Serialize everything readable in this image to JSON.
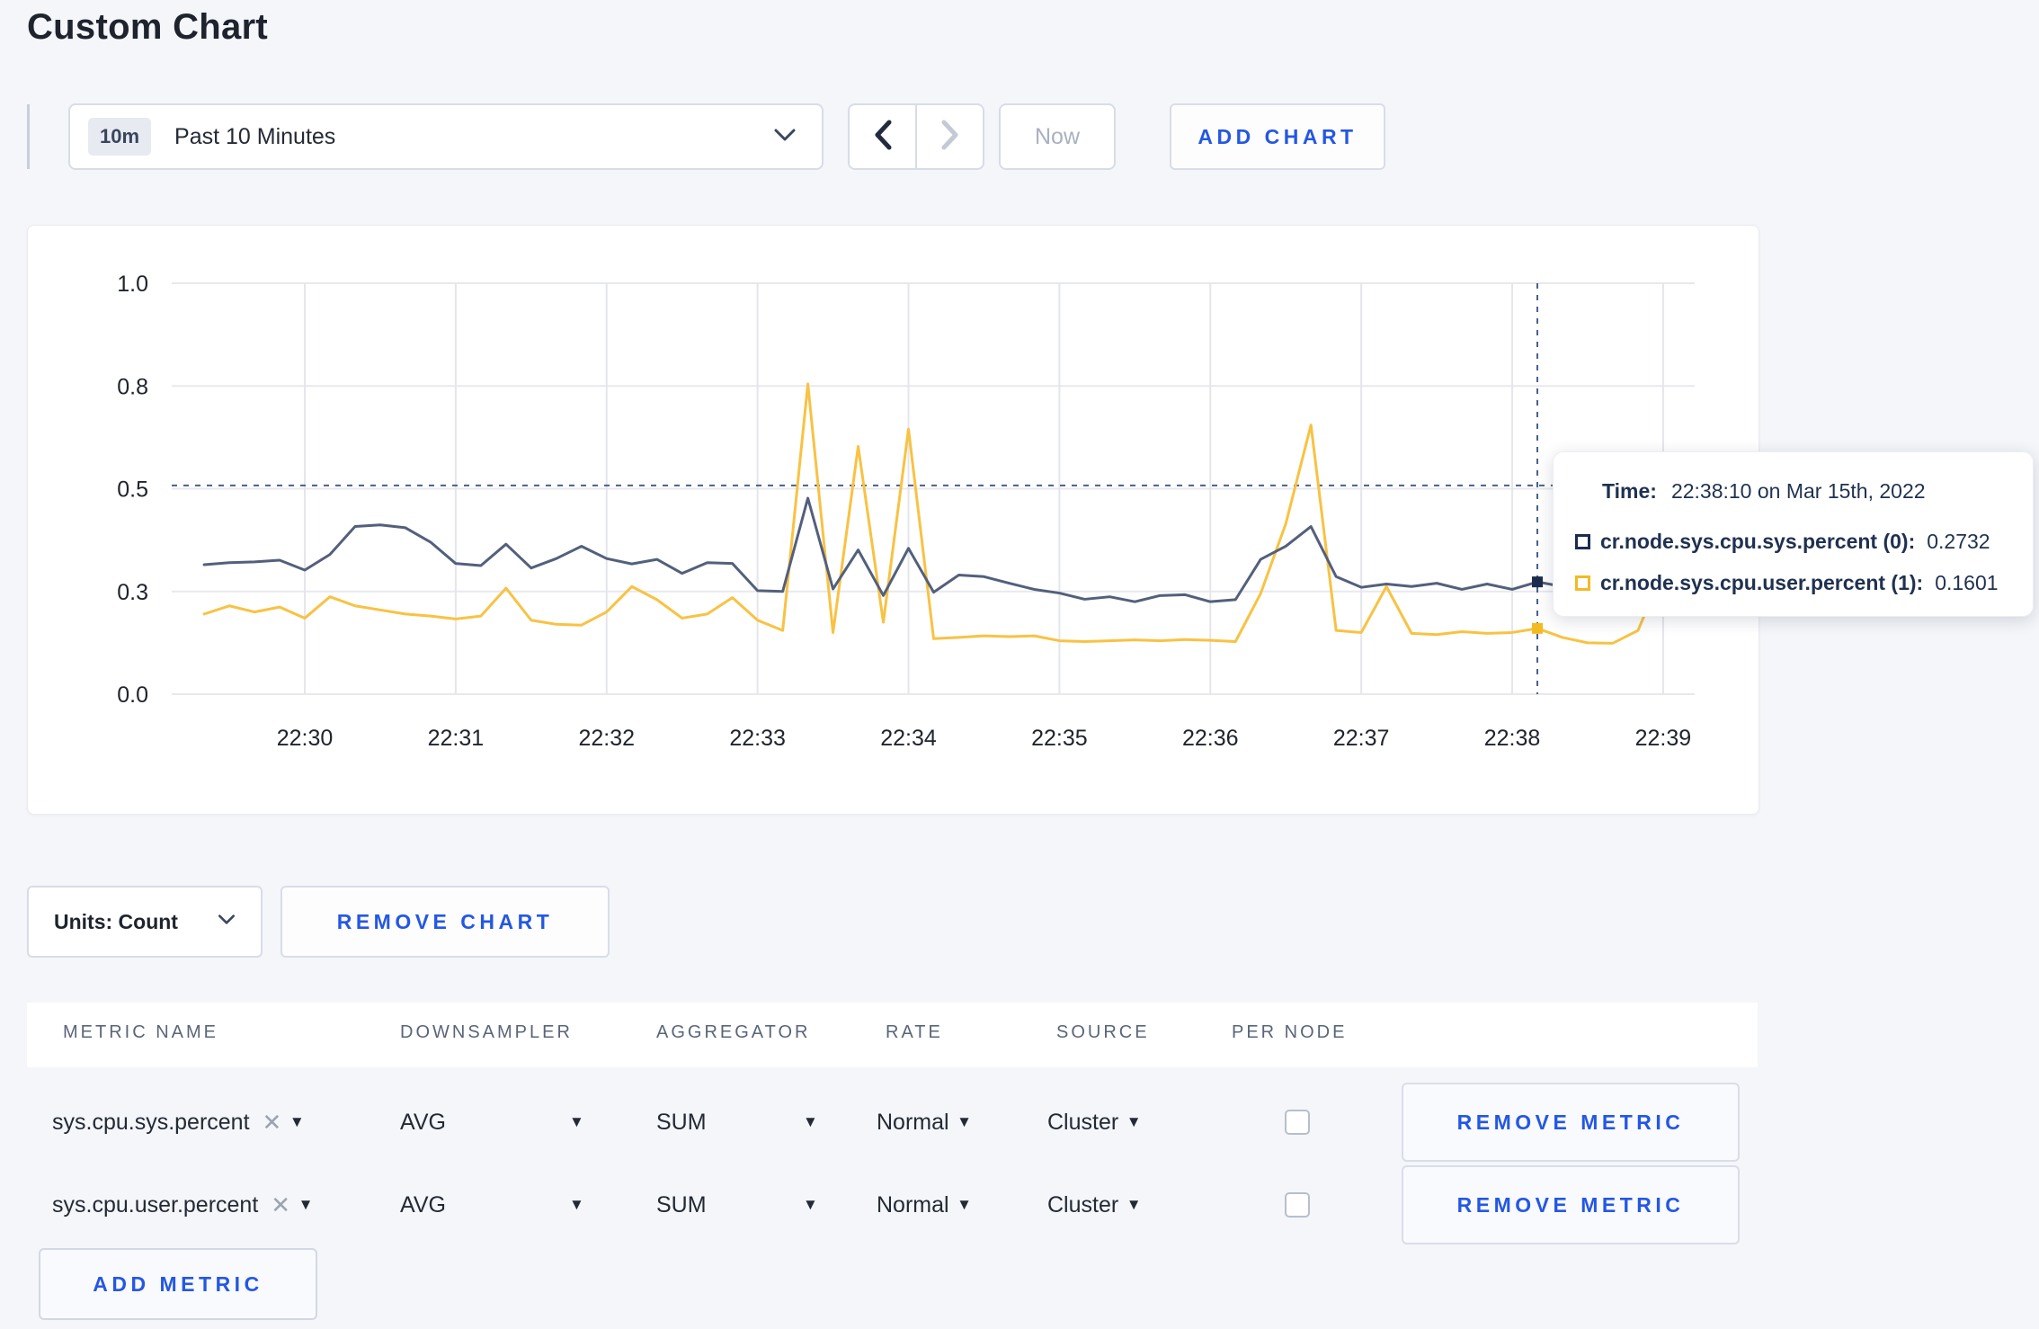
{
  "page": {
    "title": "Custom Chart",
    "background": "#f4f6f9",
    "accent_blue": "#2457e4"
  },
  "toolbar": {
    "time_selector": {
      "badge": "10m",
      "label": "Past 10 Minutes"
    },
    "now_label": "Now",
    "add_chart_label": "ADD CHART"
  },
  "chart_data": {
    "type": "line",
    "title": "",
    "xlabel": "",
    "ylabel": "",
    "ylim": [
      0,
      1
    ],
    "grid": true,
    "x_ticks": [
      "22:30",
      "22:31",
      "22:32",
      "22:33",
      "22:34",
      "22:35",
      "22:36",
      "22:37",
      "22:38",
      "22:39"
    ],
    "y_ticks": [
      {
        "label": "0.0",
        "value": 0
      },
      {
        "label": "0.3",
        "value": 0.25
      },
      {
        "label": "0.5",
        "value": 0.5
      },
      {
        "label": "0.8",
        "value": 0.75
      },
      {
        "label": "1.0",
        "value": 1.0
      }
    ],
    "x_start": "22:29:20",
    "x_interval_seconds": 10,
    "series": [
      {
        "name": "cr.node.sys.cpu.sys.percent (0)",
        "color": "#53607c",
        "swatch": "#1c2c4e",
        "values": [
          0.315,
          0.32,
          0.322,
          0.326,
          0.302,
          0.34,
          0.408,
          0.412,
          0.405,
          0.37,
          0.318,
          0.313,
          0.365,
          0.307,
          0.33,
          0.36,
          0.33,
          0.317,
          0.328,
          0.294,
          0.32,
          0.318,
          0.252,
          0.25,
          0.477,
          0.256,
          0.351,
          0.24,
          0.355,
          0.248,
          0.29,
          0.286,
          0.27,
          0.255,
          0.246,
          0.231,
          0.237,
          0.225,
          0.24,
          0.242,
          0.225,
          0.23,
          0.328,
          0.36,
          0.408,
          0.286,
          0.26,
          0.268,
          0.262,
          0.27,
          0.255,
          0.268,
          0.255,
          0.2732,
          0.262,
          0.27,
          0.288,
          0.27,
          0.29,
          0.295,
          0.3
        ]
      },
      {
        "name": "cr.node.sys.cpu.user.percent (1)",
        "color": "#f8c243",
        "swatch": "#f3ba23",
        "values": [
          0.195,
          0.215,
          0.2,
          0.212,
          0.185,
          0.237,
          0.215,
          0.205,
          0.195,
          0.19,
          0.183,
          0.19,
          0.258,
          0.18,
          0.17,
          0.168,
          0.2,
          0.262,
          0.23,
          0.185,
          0.195,
          0.235,
          0.18,
          0.155,
          0.755,
          0.15,
          0.603,
          0.175,
          0.645,
          0.135,
          0.138,
          0.142,
          0.14,
          0.142,
          0.13,
          0.128,
          0.13,
          0.132,
          0.13,
          0.133,
          0.131,
          0.128,
          0.245,
          0.415,
          0.655,
          0.155,
          0.15,
          0.262,
          0.148,
          0.145,
          0.152,
          0.148,
          0.15,
          0.1601,
          0.138,
          0.125,
          0.124,
          0.155,
          0.3,
          0.295,
          0.245
        ]
      }
    ],
    "crosshair": {
      "time": "22:38:10",
      "time_offset_seconds": 530,
      "h_line_value": 0.508,
      "point_values": [
        0.2732,
        0.1601
      ]
    },
    "legend_position": "tooltip"
  },
  "tooltip": {
    "time_label": "Time:",
    "time_value": "22:38:10 on Mar 15th, 2022",
    "series": [
      {
        "label": "cr.node.sys.cpu.sys.percent (0):",
        "value": "0.2732",
        "swatch": "#1c2c4e"
      },
      {
        "label": "cr.node.sys.cpu.user.percent (1):",
        "value": "0.1601",
        "swatch": "#f3ba23"
      }
    ]
  },
  "chart_footer": {
    "units_label": "Units: Count",
    "remove_chart_label": "REMOVE CHART"
  },
  "metrics_table": {
    "headers": [
      "METRIC NAME",
      "DOWNSAMPLER",
      "AGGREGATOR",
      "RATE",
      "SOURCE",
      "PER NODE"
    ],
    "rows": [
      {
        "metric": "sys.cpu.sys.percent",
        "downsampler": "AVG",
        "aggregator": "SUM",
        "rate": "Normal",
        "source": "Cluster",
        "per_node_checked": false
      },
      {
        "metric": "sys.cpu.user.percent",
        "downsampler": "AVG",
        "aggregator": "SUM",
        "rate": "Normal",
        "source": "Cluster",
        "per_node_checked": false
      }
    ],
    "remove_metric_label": "REMOVE METRIC",
    "add_metric_label": "ADD METRIC"
  }
}
